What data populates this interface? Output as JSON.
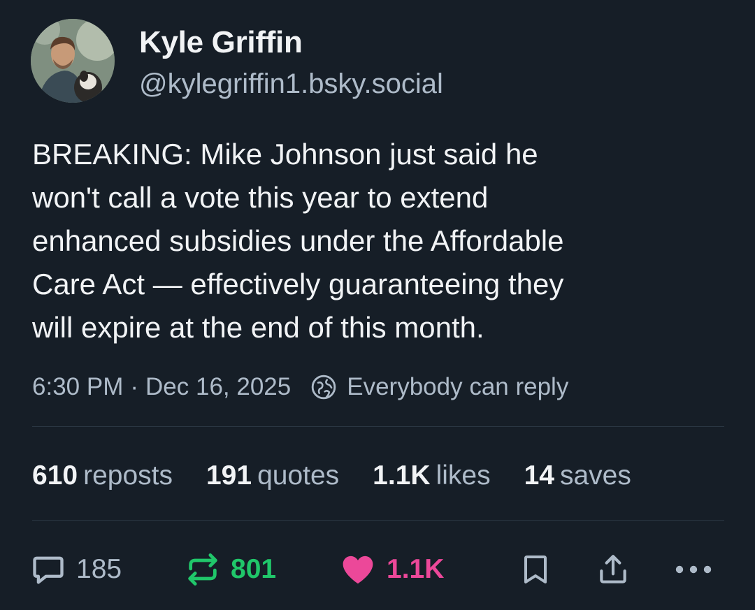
{
  "author": {
    "display_name": "Kyle Griffin",
    "handle": "@kylegriffin1.bsky.social"
  },
  "post": {
    "text_lines": [
      "BREAKING: Mike Johnson just said he",
      "won't call a vote this year to extend",
      "enhanced subsidies under the Affordable",
      "Care Act — effectively guaranteeing they",
      "will expire at the end of this month."
    ],
    "time": "6:30 PM",
    "separator": "·",
    "date": "Dec 16, 2025",
    "reply_setting": "Everybody can reply"
  },
  "stats": [
    {
      "count": "610",
      "label": "reposts"
    },
    {
      "count": "191",
      "label": "quotes"
    },
    {
      "count": "1.1K",
      "label": "likes"
    },
    {
      "count": "14",
      "label": "saves"
    }
  ],
  "actions": {
    "reply_count": "185",
    "repost_count": "801",
    "like_count": "1.1K"
  },
  "colors": {
    "background": "#161e27",
    "text_primary": "#f1f3f5",
    "text_secondary": "#aebbc9",
    "repost_active": "#20c76a",
    "like_active": "#ec4899",
    "divider": "#2b3743"
  },
  "icons": [
    "globe-icon",
    "reply-icon",
    "repost-icon",
    "heart-icon",
    "bookmark-icon",
    "share-icon",
    "more-icon"
  ]
}
